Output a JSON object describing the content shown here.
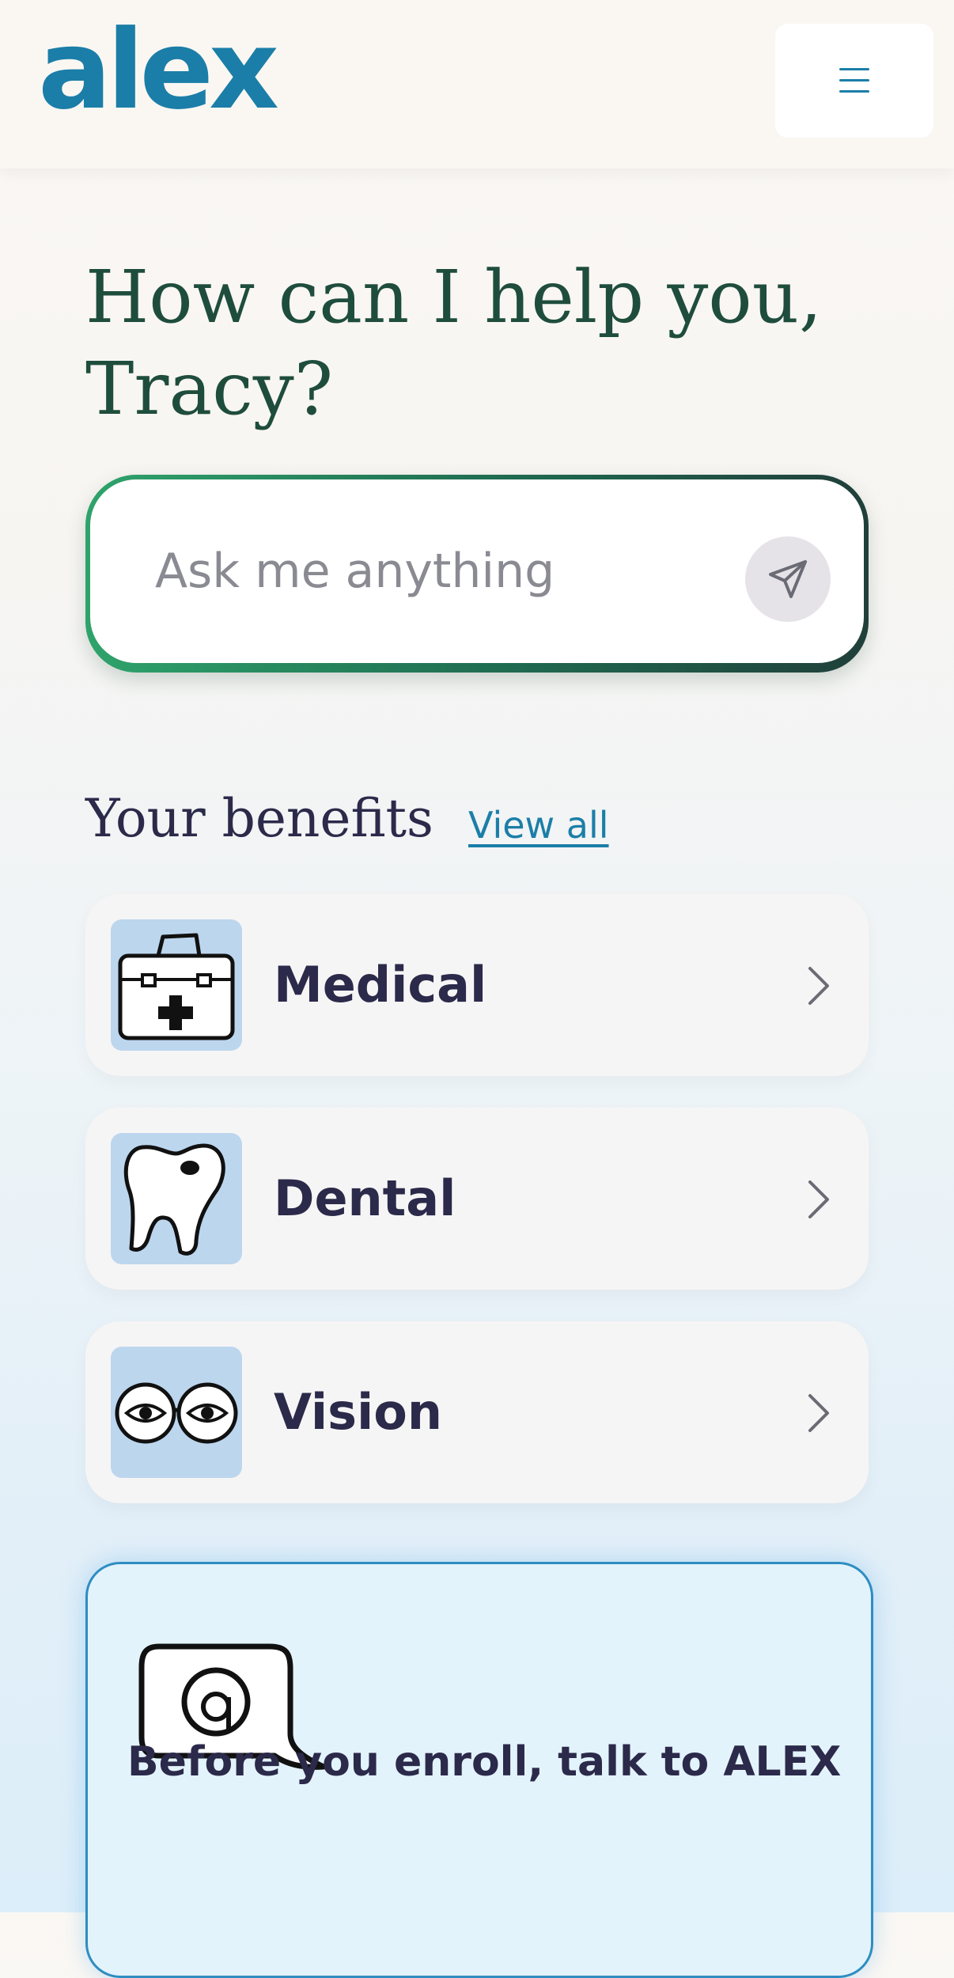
{
  "header": {
    "logo_text": "alex",
    "logo_mark": "®",
    "brand_color": "#1b7ea8",
    "menu_icon": "hamburger-menu-icon"
  },
  "greeting": {
    "line1": "How can I help you,",
    "line2": "Tracy?"
  },
  "ask": {
    "placeholder": "Ask me anything",
    "value": "",
    "send_icon": "send-paper-plane-icon"
  },
  "benefits": {
    "title": "Your benefits",
    "view_all_label": "View all",
    "items": [
      {
        "label": "Medical",
        "icon": "medical-kit-icon"
      },
      {
        "label": "Dental",
        "icon": "tooth-icon"
      },
      {
        "label": "Vision",
        "icon": "eyeglasses-icon"
      }
    ]
  },
  "enroll_card": {
    "icon": "alex-chat-bubble-icon",
    "text": "Before you enroll, talk to ALEX"
  }
}
